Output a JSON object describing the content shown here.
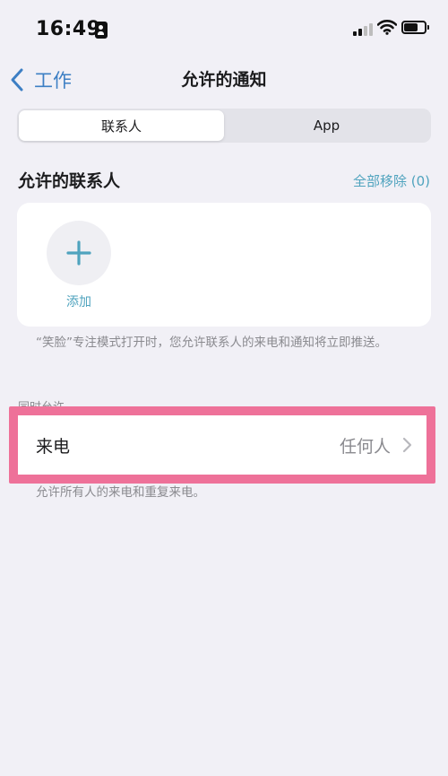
{
  "status_bar": {
    "time": "16:49"
  },
  "nav": {
    "back_label": "工作",
    "title": "允许的通知"
  },
  "segmented": {
    "options": [
      "联系人",
      "App"
    ],
    "selected": "联系人"
  },
  "contacts_section": {
    "title": "允许的联系人",
    "remove_all": "全部移除 (0)",
    "add_label": "添加",
    "footnote": "“笑脸”专注模式打开时，您允许联系人的来电和通知将立即推送。"
  },
  "also_allow": {
    "header": "同时允许",
    "calls_label": "来电",
    "calls_value": "任何人",
    "calls_footnote": "允许所有人的来电和重复来电。"
  },
  "colors": {
    "accent": "#3d7fc4",
    "teal": "#4fa3be",
    "highlight": "#ee7199",
    "background": "#f1f0f6"
  }
}
